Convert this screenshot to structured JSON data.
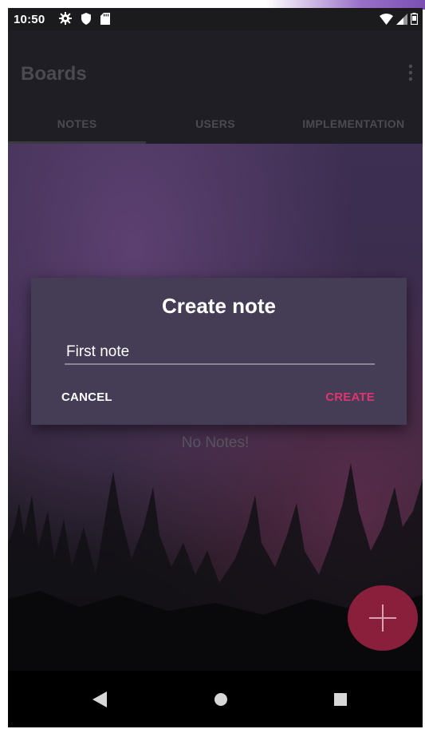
{
  "status_bar": {
    "time": "10:50",
    "icons": [
      "gear-icon",
      "shield-icon",
      "sd-card-icon",
      "wifi-icon",
      "signal-icon",
      "battery-icon"
    ]
  },
  "app_bar": {
    "title": "Boards",
    "menu_icon": "overflow-menu-icon"
  },
  "tabs": [
    {
      "label": "NOTES",
      "active": true
    },
    {
      "label": "USERS",
      "active": false
    },
    {
      "label": "IMPLEMENTATION",
      "active": false
    }
  ],
  "content": {
    "empty_message": "No Notes!"
  },
  "dialog": {
    "title": "Create note",
    "input_value": "First note",
    "cancel_label": "CANCEL",
    "create_label": "CREATE"
  },
  "fab": {
    "icon": "plus-icon"
  },
  "nav_bar": {
    "icons": [
      "back-icon",
      "home-icon",
      "recents-icon"
    ]
  },
  "colors": {
    "accent": "#e0336f",
    "fab": "#8a1f3c",
    "dialog_bg": "#443d55",
    "app_bar_bg": "#1f1e24"
  }
}
